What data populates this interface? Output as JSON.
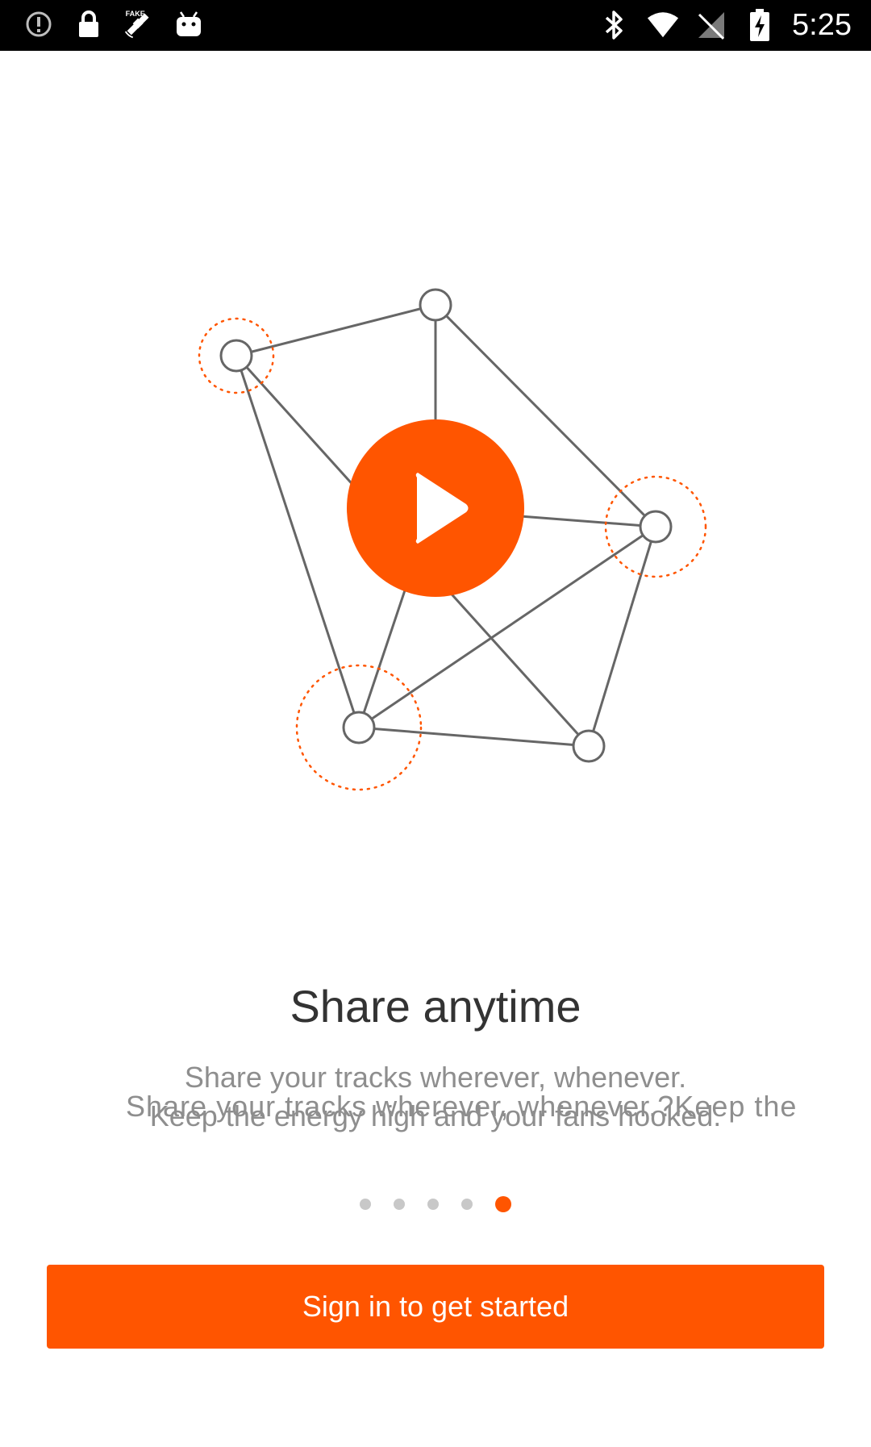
{
  "status_bar": {
    "time": "5:25",
    "left_icons": [
      "alert-circle-icon",
      "lock-icon",
      "fake-gps-satellite-icon",
      "android-icon"
    ],
    "right_icons": [
      "bluetooth-icon",
      "wifi-icon",
      "signal-off-icon",
      "battery-charging-icon"
    ]
  },
  "onboarding": {
    "title": "Share anytime",
    "subtitle_line1": "Share your tracks wherever, whenever.",
    "subtitle_line2": "Keep the energy high and your fans hooked.",
    "subtitle_overlay": "Share your tracks wherever, whenever.?Keep the",
    "pager": {
      "count": 5,
      "active_index": 4
    },
    "signin_label": "Sign in to get started"
  },
  "colors": {
    "accent": "#ff5500",
    "title": "#333333",
    "subtitle": "#8e8e8e",
    "dot_inactive": "#c8c8c8",
    "status_bar": "#000000",
    "network_line": "#666666"
  }
}
